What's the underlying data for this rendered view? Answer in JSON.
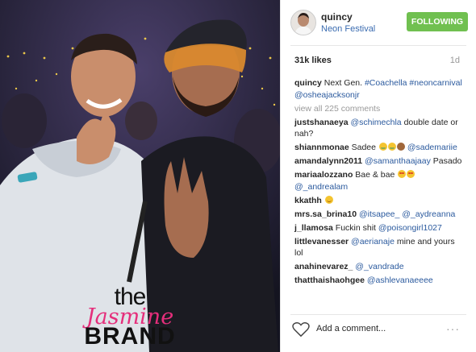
{
  "post": {
    "username": "quincy",
    "location": "Neon Festival",
    "follow_label": "FOLLOWING",
    "likes": "31k likes",
    "time_ago": "1d",
    "view_all": "view all 225 comments",
    "add_comment": "Add a comment...",
    "more": "···"
  },
  "watermark": {
    "line1": "the",
    "line2": "Jasmine",
    "line3": "BRAND"
  },
  "comments": [
    {
      "user": "quincy",
      "text": "Next Gen.",
      "tags": "#Coachella #neoncarnival @osheajacksonjr",
      "icons": []
    },
    {
      "user": "justshanaeya",
      "tags": "@schimechla",
      "text": "double date or nah?",
      "icons": []
    },
    {
      "user": "shiannmonae",
      "text": "Sadee",
      "tags": "@sademariie",
      "icons": [
        "laugh",
        "laugh",
        "monkey"
      ]
    },
    {
      "user": "amandalynn2011",
      "tags": "@samanthaajaay",
      "text": "Pasado",
      "icons": []
    },
    {
      "user": "mariaalozzano",
      "text": "Bae & bae",
      "tags": "@_andrealam",
      "icons": [
        "heart",
        "heart"
      ]
    },
    {
      "user": "kkathh",
      "text": "",
      "tags": "",
      "icons": [
        "smile"
      ]
    },
    {
      "user": "mrs.sa_brina10",
      "tags": "@itsapee_ @_aydreanna",
      "text": "",
      "icons": []
    },
    {
      "user": "j_llamosa",
      "text": "Fuckin shit",
      "tags": "@poisongirl1027",
      "icons": []
    },
    {
      "user": "littlevanesser",
      "tags": "@aerianaje",
      "text": "mine and yours lol",
      "icons": []
    },
    {
      "user": "anahinevarez_",
      "tags": "@_vandrade",
      "text": "",
      "icons": []
    },
    {
      "user": "thatthaishaohgee",
      "tags": "@ashlevanaeeee",
      "text": "",
      "icons": []
    }
  ],
  "colors": {
    "follow_button": "#70c050",
    "tag_link": "#2b5a9e",
    "watermark_pink": "#e52e7b"
  },
  "icons": [
    "heart-icon",
    "more-options-icon",
    "avatar"
  ]
}
